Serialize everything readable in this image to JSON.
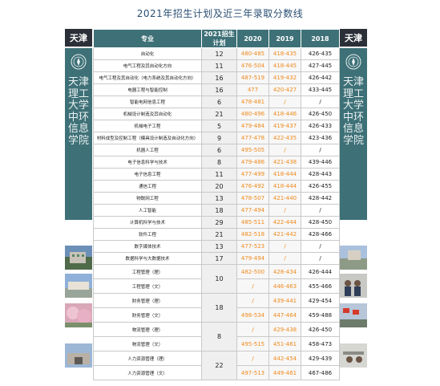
{
  "page": {
    "title": "2021年招生计划及近三年录取分数线"
  },
  "side": {
    "region": "天津",
    "school_vertical": "天津理工大学中环信息学院"
  },
  "table": {
    "headers": {
      "major": "专业",
      "plan": "2021招生计划",
      "y2020": "2020",
      "y2019": "2019",
      "y2018": "2018"
    },
    "rows": [
      {
        "major": "自动化",
        "plan": "12",
        "y2020": "480-485",
        "y2019": "418-435",
        "y2018": "426-435"
      },
      {
        "major": "电气工程及其自动化方向",
        "plan": "11",
        "y2020": "476-504",
        "y2019": "418-445",
        "y2018": "427-445"
      },
      {
        "major": "电气工程及其自动化（电力系统及其自动化方向）",
        "plan": "16",
        "y2020": "487-519",
        "y2019": "419-432",
        "y2018": "426-442"
      },
      {
        "major": "电器工程与智能控制",
        "plan": "16",
        "y2020": "477",
        "y2019": "420-427",
        "y2018": "433-445"
      },
      {
        "major": "智能电网信息工程",
        "plan": "6",
        "y2020": "478-481",
        "y2019": "/",
        "y2018": "/"
      },
      {
        "major": "机械设计制造及其自动化",
        "plan": "21",
        "y2020": "480-496",
        "y2019": "418-446",
        "y2018": "426-450"
      },
      {
        "major": "机械电子工程",
        "plan": "5",
        "y2020": "479-484",
        "y2019": "419-437",
        "y2018": "426-433"
      },
      {
        "major": "材料成型及控制工程（模具设计制造及自动化方向）",
        "plan": "9",
        "y2020": "477-478",
        "y2019": "422-435",
        "y2018": "423-436"
      },
      {
        "major": "机器人工程",
        "plan": "6",
        "y2020": "495-505",
        "y2019": "/",
        "y2018": "/"
      },
      {
        "major": "电子信息科学与技术",
        "plan": "8",
        "y2020": "479-486",
        "y2019": "421-438",
        "y2018": "439-446"
      },
      {
        "major": "电子信息工程",
        "plan": "11",
        "y2020": "477-499",
        "y2019": "418-444",
        "y2018": "428-443"
      },
      {
        "major": "通信工程",
        "plan": "20",
        "y2020": "476-492",
        "y2019": "418-444",
        "y2018": "426-455"
      },
      {
        "major": "物联网工程",
        "plan": "13",
        "y2020": "478-507",
        "y2019": "421-440",
        "y2018": "428-442"
      },
      {
        "major": "人工智能",
        "plan": "18",
        "y2020": "477-494",
        "y2019": "/",
        "y2018": "/"
      },
      {
        "major": "计算机科学与技术",
        "plan": "29",
        "y2020": "485-511",
        "y2019": "422-444",
        "y2018": "428-450"
      },
      {
        "major": "软件工程",
        "plan": "21",
        "y2020": "482-518",
        "y2019": "421-442",
        "y2018": "428-466"
      },
      {
        "major": "数字媒体技术",
        "plan": "13",
        "y2020": "477-523",
        "y2019": "/",
        "y2018": "/"
      },
      {
        "major": "数据科学与大数据技术",
        "plan": "17",
        "y2020": "479-494",
        "y2019": "/",
        "y2018": "/"
      },
      {
        "major": "工程管理（理）",
        "plan": "10",
        "y2020": "482-500",
        "y2019": "428-434",
        "y2018": "426-444"
      },
      {
        "major": "工程管理（文）",
        "plan": "",
        "y2020": "/",
        "y2019": "446-463",
        "y2018": "455-466"
      },
      {
        "major": "财务管理（理）",
        "plan": "18",
        "y2020": "/",
        "y2019": "439-441",
        "y2018": "429-454"
      },
      {
        "major": "财务管理（文）",
        "plan": "",
        "y2020": "498-534",
        "y2019": "447-464",
        "y2018": "459-488"
      },
      {
        "major": "物流管理（理）",
        "plan": "8",
        "y2020": "/",
        "y2019": "429-438",
        "y2018": "426-450"
      },
      {
        "major": "物流管理（文）",
        "plan": "",
        "y2020": "495-515",
        "y2019": "451-461",
        "y2018": "458-473"
      },
      {
        "major": "人力资源管理（理）",
        "plan": "22",
        "y2020": "/",
        "y2019": "442-454",
        "y2018": "429-439"
      },
      {
        "major": "人力资源管理（文）",
        "plan": "",
        "y2020": "497-513",
        "y2019": "449-461",
        "y2018": "467-486"
      }
    ]
  },
  "colors": {
    "teal": "#3e7077",
    "orange": "#f08a1c",
    "title": "#2a4f73"
  }
}
